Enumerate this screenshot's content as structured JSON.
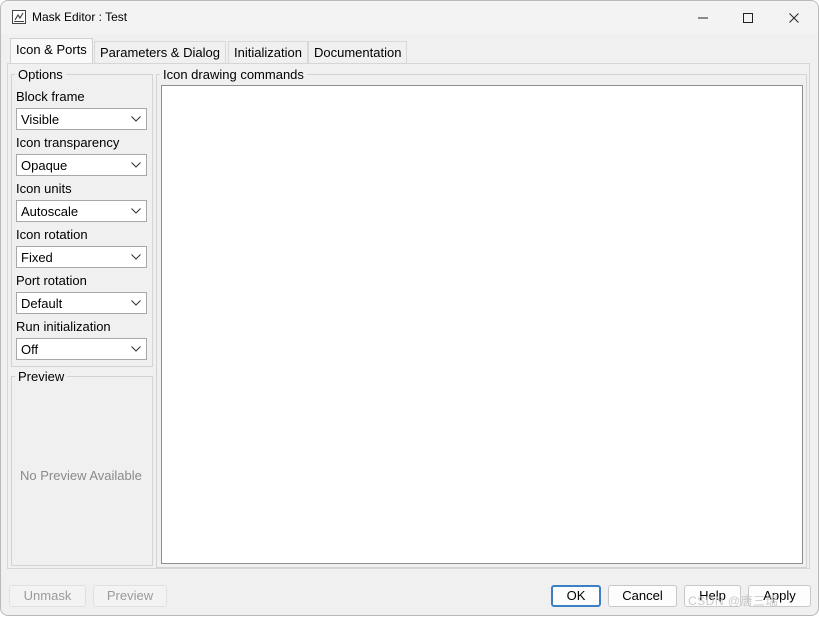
{
  "window": {
    "title": "Mask Editor : Test",
    "controls": [
      "minimize-icon",
      "maximize-icon",
      "close-icon"
    ]
  },
  "tabs": [
    {
      "label": "Icon & Ports",
      "active": true
    },
    {
      "label": "Parameters & Dialog",
      "active": false
    },
    {
      "label": "Initialization",
      "active": false
    },
    {
      "label": "Documentation",
      "active": false
    }
  ],
  "options": {
    "legend": "Options",
    "fields": [
      {
        "label": "Block frame",
        "value": "Visible"
      },
      {
        "label": "Icon transparency",
        "value": "Opaque"
      },
      {
        "label": "Icon units",
        "value": "Autoscale"
      },
      {
        "label": "Icon rotation",
        "value": "Fixed"
      },
      {
        "label": "Port rotation",
        "value": "Default"
      },
      {
        "label": "Run initialization",
        "value": "Off"
      }
    ]
  },
  "preview": {
    "legend": "Preview",
    "placeholder": "No Preview Available"
  },
  "icon_drawing": {
    "legend": "Icon drawing commands"
  },
  "buttons": {
    "unmask": "Unmask",
    "preview": "Preview",
    "ok": "OK",
    "cancel": "Cancel",
    "help": "Help",
    "apply": "Apply"
  },
  "watermark": "CSDN @唐三瑞",
  "colors": {
    "window_bg": "#f0f0f0",
    "default_button_border": "#3c7fc7",
    "disabled_text": "#9a9a9a"
  }
}
